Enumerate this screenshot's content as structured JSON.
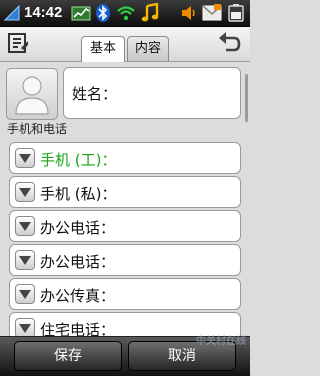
{
  "status_bar": {
    "time": "14:42",
    "icons": [
      "signal-icon",
      "chart-icon",
      "bluetooth-icon",
      "wifi-icon",
      "music-icon",
      "speaker-icon",
      "message-icon",
      "battery-icon"
    ]
  },
  "toolbar": {
    "tabs": [
      {
        "label": "基本",
        "active": true
      },
      {
        "label": "内容",
        "active": false
      }
    ]
  },
  "contact": {
    "name_label": "姓名："
  },
  "section_title": "手机和电话",
  "phone_fields": [
    {
      "label": "手机 (工)：",
      "active": true
    },
    {
      "label": "手机 (私)：",
      "active": false
    },
    {
      "label": "办公电话：",
      "active": false
    },
    {
      "label": "办公电话：",
      "active": false
    },
    {
      "label": "办公传真：",
      "active": false
    },
    {
      "label": "住宅电话：",
      "active": false
    }
  ],
  "bottom_bar": {
    "save_label": "保存",
    "cancel_label": "取消"
  },
  "watermark": "中关村在线",
  "colors": {
    "active_label": "#19a319",
    "status_bar": "#1a1a1a",
    "accent_orange": "#f08a00"
  }
}
